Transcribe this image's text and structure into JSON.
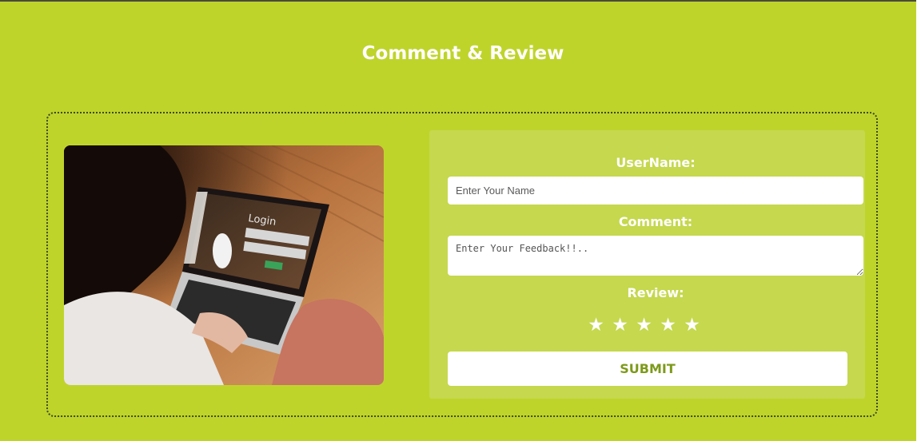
{
  "page": {
    "title": "Comment & Review"
  },
  "form": {
    "username_label": "UserName:",
    "username_placeholder": "Enter Your Name",
    "comment_label": "Comment:",
    "comment_placeholder": "Enter Your Feedback!!..",
    "review_label": "Review:",
    "stars": [
      "★",
      "★",
      "★",
      "★",
      "★"
    ],
    "submit_label": "SUBMIT"
  },
  "photo": {
    "screen_text": "Login"
  },
  "colors": {
    "background": "#bfd42b",
    "panel": "#c5d84e",
    "accent_text": "#7d9a1a",
    "border": "#3c4a1c"
  }
}
